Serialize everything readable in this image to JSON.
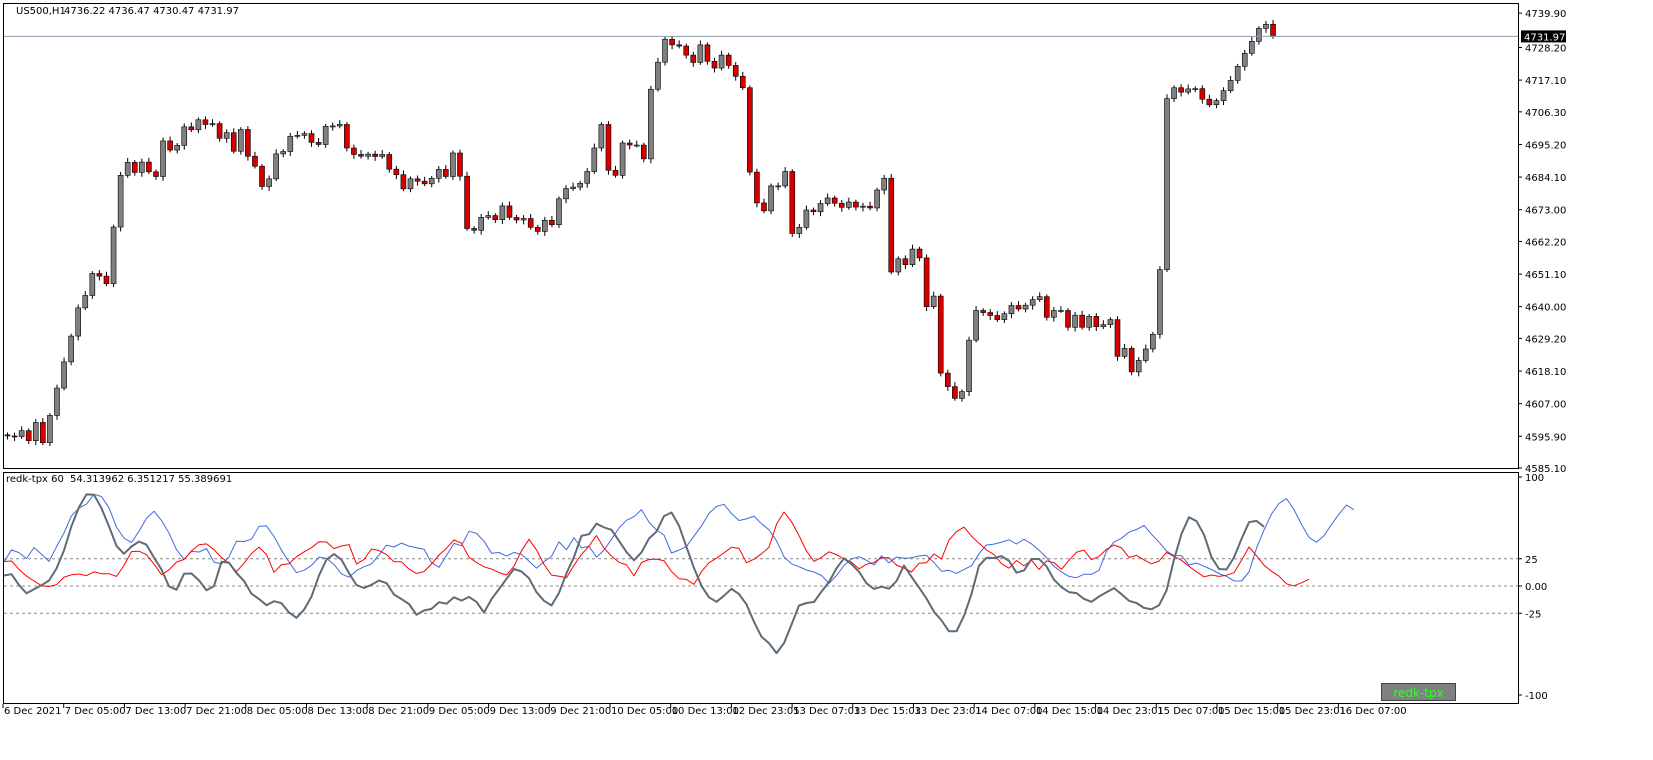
{
  "main_header": {
    "symbol": "US500,H1",
    "ohlc": "4736.22 4736.47 4730.47 4731.97"
  },
  "current_price_label": "4731.97",
  "indicator_header": {
    "name": "redk-tpx 60",
    "values": "54.313962 6.351217 55.389691"
  },
  "indicator_button_label": "redk-tpx",
  "colors": {
    "bull_body": "#808080",
    "bear_body": "#d40000",
    "wick": "#000000",
    "line_blue": "#4169e1",
    "line_red": "#ff0000",
    "line_gray": "#5f6b76",
    "button_text": "#2bff2b"
  },
  "chart_data": [
    {
      "type": "candlestick",
      "ylim": [
        4585.1,
        4743
      ],
      "y_ticks": [
        "4739.90",
        "4728.20",
        "4717.10",
        "4706.30",
        "4695.20",
        "4684.10",
        "4673.00",
        "4662.20",
        "4651.10",
        "4640.00",
        "4629.20",
        "4618.10",
        "4607.00",
        "4595.90",
        "4585.10"
      ],
      "x_ticks": [
        "6 Dec 2021",
        "7 Dec 05:00",
        "7 Dec 13:00",
        "7 Dec 21:00",
        "8 Dec 05:00",
        "8 Dec 13:00",
        "8 Dec 21:00",
        "9 Dec 05:00",
        "9 Dec 13:00",
        "9 Dec 21:00",
        "10 Dec 05:00",
        "10 Dec 13:00",
        "12 Dec 23:05",
        "13 Dec 07:03",
        "13 Dec 15:03",
        "13 Dec 23:01",
        "14 Dec 07:00",
        "14 Dec 15:00",
        "14 Dec 23:01",
        "15 Dec 07:00",
        "15 Dec 15:00",
        "15 Dec 23:01",
        "16 Dec 07:00"
      ],
      "closes": [
        4596.0,
        4595.8,
        4597.8,
        4594.4,
        4600.6,
        4593.7,
        4603.0,
        4612.3,
        4621.2,
        4630.0,
        4639.6,
        4643.8,
        4651.3,
        4650.4,
        4647.8,
        4667.1,
        4684.7,
        4689.1,
        4685.7,
        4689.2,
        4685.9,
        4684.3,
        4696.4,
        4693.3,
        4694.9,
        4701.2,
        4700.2,
        4703.6,
        4702.0,
        4702.3,
        4697.3,
        4699.2,
        4692.9,
        4700.3,
        4691.2,
        4687.8,
        4680.9,
        4683.5,
        4692.0,
        4692.8,
        4698.0,
        4698.3,
        4698.9,
        4695.9,
        4695.2,
        4701.4,
        4701.5,
        4702.0,
        4694.0,
        4691.8,
        4691.2,
        4691.9,
        4691.1,
        4691.8,
        4686.8,
        4684.9,
        4680.1,
        4683.5,
        4682.7,
        4681.8,
        4683.7,
        4686.7,
        4684.3,
        4692.3,
        4684.4,
        4666.6,
        4666.0,
        4670.4,
        4671.0,
        4669.6,
        4674.3,
        4670.4,
        4669.5,
        4670.0,
        4667.0,
        4665.6,
        4669.4,
        4667.9,
        4676.7,
        4680.2,
        4680.7,
        4682.0,
        4686.0,
        4694.0,
        4702.0,
        4686.4,
        4684.7,
        4695.7,
        4695.0,
        4695.0,
        4690.3,
        4714.0,
        4723.2,
        4731.0,
        4729.1,
        4728.7,
        4725.6,
        4723.1,
        4729.1,
        4723.5,
        4721.2,
        4725.6,
        4722.1,
        4718.4,
        4714.5,
        4685.8,
        4675.3,
        4672.6,
        4681.1,
        4681.1,
        4686.0,
        4664.9,
        4667.0,
        4672.9,
        4672.3,
        4675.1,
        4677.0,
        4675.2,
        4673.8,
        4675.6,
        4673.9,
        4674.2,
        4673.6,
        4679.7,
        4683.7,
        4651.8,
        4656.3,
        4654.3,
        4659.6,
        4656.6,
        4640.0,
        4643.6,
        4617.4,
        4612.8,
        4608.8,
        4611.1,
        4628.6,
        4638.7,
        4638.0,
        4637.0,
        4635.6,
        4637.6,
        4640.4,
        4639.2,
        4640.5,
        4642.4,
        4643.4,
        4636.4,
        4638.7,
        4638.7,
        4633.0,
        4637.1,
        4633.0,
        4636.7,
        4633.2,
        4633.9,
        4635.6,
        4623.1,
        4625.8,
        4617.8,
        4621.7,
        4625.6,
        4630.6,
        4652.6,
        4710.8,
        4714.5,
        4713.0,
        4714.1,
        4714.2,
        4710.6,
        4708.7,
        4710.1,
        4713.5,
        4717.0,
        4721.8,
        4726.2,
        4730.3,
        4734.7,
        4736.1,
        4731.97
      ]
    },
    {
      "type": "line",
      "ylim": [
        -100,
        100
      ],
      "y_ticks": [
        "100",
        "25",
        "0.00",
        "-25",
        "-100"
      ],
      "reference_lines": [
        25,
        0,
        -25
      ],
      "series": [
        {
          "color_key": "line_blue",
          "values": [
            22.1,
            33.1,
            30.6,
            25.1,
            35.3,
            29.1,
            22.6,
            36.0,
            48.6,
            64.4,
            71.5,
            75.1,
            84.1,
            82.1,
            71.7,
            53.9,
            43.9,
            39.9,
            50.3,
            62.1,
            68.6,
            60.2,
            48.5,
            33.3,
            24.5,
            31.7,
            31.2,
            34.4,
            21.9,
            20.2,
            26.8,
            41.1,
            40.8,
            42.9,
            54.7,
            55.1,
            45.4,
            32.8,
            21.9,
            12.2,
            14.4,
            18.9,
            26.6,
            25.3,
            19.8,
            11.1,
            8.1,
            14.1,
            17.6,
            20.3,
            28.5,
            37.5,
            35.8,
            39.4,
            36.6,
            35.1,
            33.8,
            21.5,
            17.2,
            28.0,
            39.1,
            37.0,
            50.2,
            48.3,
            41.1,
            30.1,
            30.7,
            27.4,
            30.8,
            29.0,
            22.8,
            16.4,
            22.3,
            27.2,
            40.5,
            33.2,
            44.2,
            34.9,
            36.4,
            26.4,
            32.9,
            42.8,
            53.2,
            60.3,
            63.7,
            70.0,
            58.6,
            51.4,
            46.8,
            30.3,
            32.9,
            36.2,
            45.8,
            55.1,
            66.6,
            73.0,
            75.0,
            66.4,
            60.1,
            61.6,
            64.1,
            57.1,
            51.6,
            41.6,
            26.9,
            20.4,
            17.7,
            14.7,
            12.8,
            9.6,
            2.4,
            9.6,
            18.8,
            24.8,
            26.9,
            23.6,
            19.3,
            27.6,
            21.2,
            26.6,
            25.4,
            26.0,
            27.5,
            28.2,
            21.5,
            13.6,
            14.4,
            11.6,
            15.2,
            18.5,
            29.6,
            37.6,
            38.4,
            40.3,
            42.4,
            38.5,
            42.9,
            38.6,
            32.8,
            26.1,
            18.1,
            12.9,
            8.8,
            7.6,
            10.8,
            10.7,
            14.4,
            31.8,
            40.3,
            43.8,
            49.4,
            51.8,
            55.6,
            47.4,
            40.3,
            32.0,
            27.9,
            27.8,
            19.3,
            21.1,
            18.1,
            15.1,
            11.4,
            8.9,
            4.7,
            4.6,
            12.8,
            34.7,
            51.2,
            66.1,
            75.8,
            80.2,
            70.1,
            56.5,
            44.6,
            40.2,
            46.1,
            56.5,
            66.0,
            74.2,
            69.9
          ]
        },
        {
          "color_key": "line_red",
          "values": [
            22.5,
            22.9,
            15.3,
            9.1,
            4.6,
            0.3,
            -0.5,
            1.2,
            8.2,
            10.3,
            11.0,
            9.5,
            12.9,
            11.3,
            11.3,
            8.8,
            18.9,
            31.6,
            31.9,
            28.7,
            20.1,
            10.4,
            14.9,
            21.9,
            24.4,
            32.2,
            37.9,
            38.6,
            33.3,
            26.2,
            20.8,
            13.2,
            20.9,
            29.8,
            35.7,
            28.8,
            12.6,
            19.6,
            20.4,
            26.8,
            31.3,
            35.1,
            40.6,
            40.4,
            34.3,
            36.7,
            38.0,
            20.1,
            24.4,
            33.9,
            32.5,
            28.8,
            22.3,
            22.2,
            15.5,
            11.6,
            13.2,
            20.2,
            28.4,
            34.7,
            42.3,
            39.3,
            26.3,
            21.6,
            17.6,
            15.5,
            12.3,
            10.1,
            18.2,
            32.3,
            42.8,
            33.1,
            19.8,
            10.0,
            8.9,
            7.6,
            19.0,
            29.0,
            36.6,
            46.3,
            34.7,
            27.4,
            21.7,
            19.4,
            9.3,
            21.6,
            24.3,
            24.7,
            23.2,
            13.3,
            6.7,
            6.1,
            1.5,
            13.2,
            21.3,
            25.5,
            30.4,
            35.5,
            34.5,
            21.4,
            24.6,
            29.5,
            35.5,
            56.6,
            67.9,
            59.0,
            46.3,
            32.0,
            22.6,
            26.2,
            31.4,
            28.8,
            24.8,
            21.8,
            15.8,
            20.0,
            21.5,
            26.1,
            25.9,
            19.2,
            16.4,
            12.8,
            20.8,
            21.4,
            29.4,
            24.9,
            42.2,
            49.9,
            54.0,
            45.8,
            39.2,
            33.0,
            28.8,
            20.5,
            16.3,
            23.4,
            18.4,
            23.8,
            15.1,
            23.0,
            21.4,
            15.3,
            23.6,
            31.0,
            32.9,
            24.1,
            27.2,
            33.7,
            37.6,
            35.0,
            26.2,
            28.1,
            23.9,
            20.4,
            22.8,
            30.8,
            27.2,
            23.6,
            18.0,
            13.0,
            8.4,
            10.1,
            8.8,
            9.9,
            12.2,
            23.7,
            35.8,
            27.7,
            19.1,
            13.5,
            9.0,
            2.0,
            0.2,
            2.9,
            6.2
          ]
        },
        {
          "color_key": "line_gray",
          "values": [
            9.6,
            10.8,
            0.8,
            -6.7,
            -2.9,
            0.6,
            5.0,
            16.1,
            32.7,
            55.0,
            72.2,
            84.0,
            83.8,
            71.4,
            54.7,
            36.8,
            29.5,
            36.2,
            40.7,
            37.9,
            26.1,
            15.1,
            -0.4,
            -3.4,
            11.2,
            11.5,
            5.1,
            -3.9,
            -0.1,
            22.2,
            21.4,
            11.9,
            4.7,
            -7.1,
            -11.9,
            -17.6,
            -13.9,
            -15.8,
            -24.3,
            -29.2,
            -21.8,
            -9.7,
            9.7,
            24.3,
            29.3,
            24.0,
            11.8,
            0.8,
            -1.8,
            1.1,
            5.0,
            2.6,
            -7.8,
            -12.0,
            -16.5,
            -26.4,
            -22.5,
            -21.0,
            -14.9,
            -16.2,
            -10.4,
            -13.4,
            -10.0,
            -14.6,
            -24.3,
            -12.1,
            -2.8,
            6.6,
            15.7,
            13.3,
            7.1,
            -5.7,
            -13.6,
            -17.9,
            -6.3,
            11.7,
            26.6,
            46.1,
            47.5,
            57.2,
            53.8,
            51.6,
            41.5,
            31.1,
            23.6,
            30.9,
            43.6,
            49.9,
            64.1,
            67.4,
            55.4,
            35.7,
            16.4,
            0.1,
            -10.4,
            -14.5,
            -8.9,
            -2.6,
            -7.4,
            -16.9,
            -32.8,
            -46.6,
            -52.5,
            -61.6,
            -52.4,
            -35.4,
            -17.9,
            -15.6,
            -14.7,
            -5.1,
            3.7,
            16.2,
            25.4,
            20.0,
            13.1,
            2.5,
            -2.7,
            -0.6,
            -2.5,
            4.5,
            18.8,
            8.4,
            -1.3,
            -11.5,
            -23.7,
            -31.6,
            -41.6,
            -41.6,
            -27.3,
            -7.3,
            18.6,
            25.9,
            25.6,
            27.4,
            23.0,
            12.2,
            14.3,
            24.7,
            24.9,
            18.1,
            5.8,
            -1.1,
            -5.6,
            -6.5,
            -11.8,
            -14.5,
            -9.6,
            -5.8,
            -1.9,
            -7.5,
            -13.6,
            -15.6,
            -20.1,
            -21.4,
            -17.7,
            -4.2,
            24.2,
            47.8,
            63.1,
            59.5,
            47.1,
            26.5,
            15.6,
            15.1,
            26.2,
            43.1,
            58.5,
            59.7,
            54.3
          ]
        }
      ]
    }
  ]
}
